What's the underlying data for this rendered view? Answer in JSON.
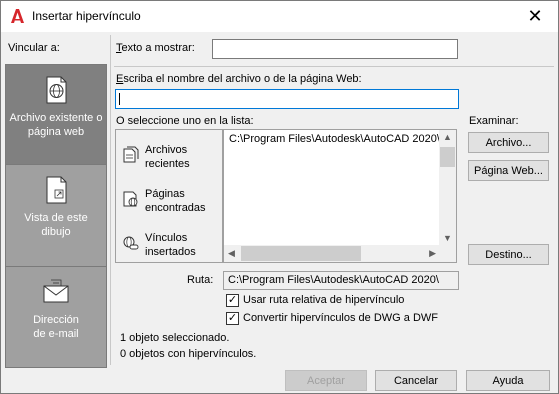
{
  "window": {
    "title": "Insertar hipervínculo",
    "close_glyph": "✕"
  },
  "link_to_label": "Vincular a:",
  "text_to_display": {
    "label": "Texto a mostrar:",
    "value": ""
  },
  "filename_prompt": "Escriba el nombre del archivo o de la página Web:",
  "filename_value": "",
  "select_from_list": "O seleccione uno en la lista:",
  "browse_label": "Examinar:",
  "left_panel": [
    {
      "label_line1": "Archivo existente o",
      "label_line2": "página web",
      "icon": "globe-document-icon",
      "selected": true
    },
    {
      "label_line1": "Vista de este",
      "label_line2": "dibujo",
      "icon": "drawing-view-icon",
      "selected": false
    },
    {
      "label_line1": "Dirección",
      "label_line2": "de e-mail",
      "icon": "envelope-icon",
      "selected": false
    }
  ],
  "list_items": [
    {
      "line1": "Archivos",
      "line2": "recientes",
      "icon": "recent-files-icon"
    },
    {
      "line1": "Páginas",
      "line2": "encontradas",
      "icon": "browsed-pages-icon"
    },
    {
      "line1": "Vínculos",
      "line2": "insertados",
      "icon": "inserted-links-icon"
    }
  ],
  "file_list": [
    "C:\\Program Files\\Autodesk\\AutoCAD 2020\\"
  ],
  "buttons": {
    "file": "Archivo...",
    "web_page": "Página Web...",
    "target": "Destino...",
    "ok": "Aceptar",
    "cancel": "Cancelar",
    "help": "Ayuda"
  },
  "path": {
    "label": "Ruta:",
    "value": "C:\\Program Files\\Autodesk\\AutoCAD 2020\\"
  },
  "checkboxes": [
    {
      "label": "Usar ruta relativa de hipervínculo",
      "checked": true
    },
    {
      "label": "Convertir hipervínculos de DWG a DWF",
      "checked": true
    }
  ],
  "status": {
    "selected": "1 objeto seleccionado.",
    "with_links": "0 objetos con hipervínculos."
  },
  "colors": {
    "accent": "#0078d7",
    "left_panel": "#a0a0a0",
    "left_panel_selected": "#808080",
    "autocad_red": "#d6262b"
  }
}
